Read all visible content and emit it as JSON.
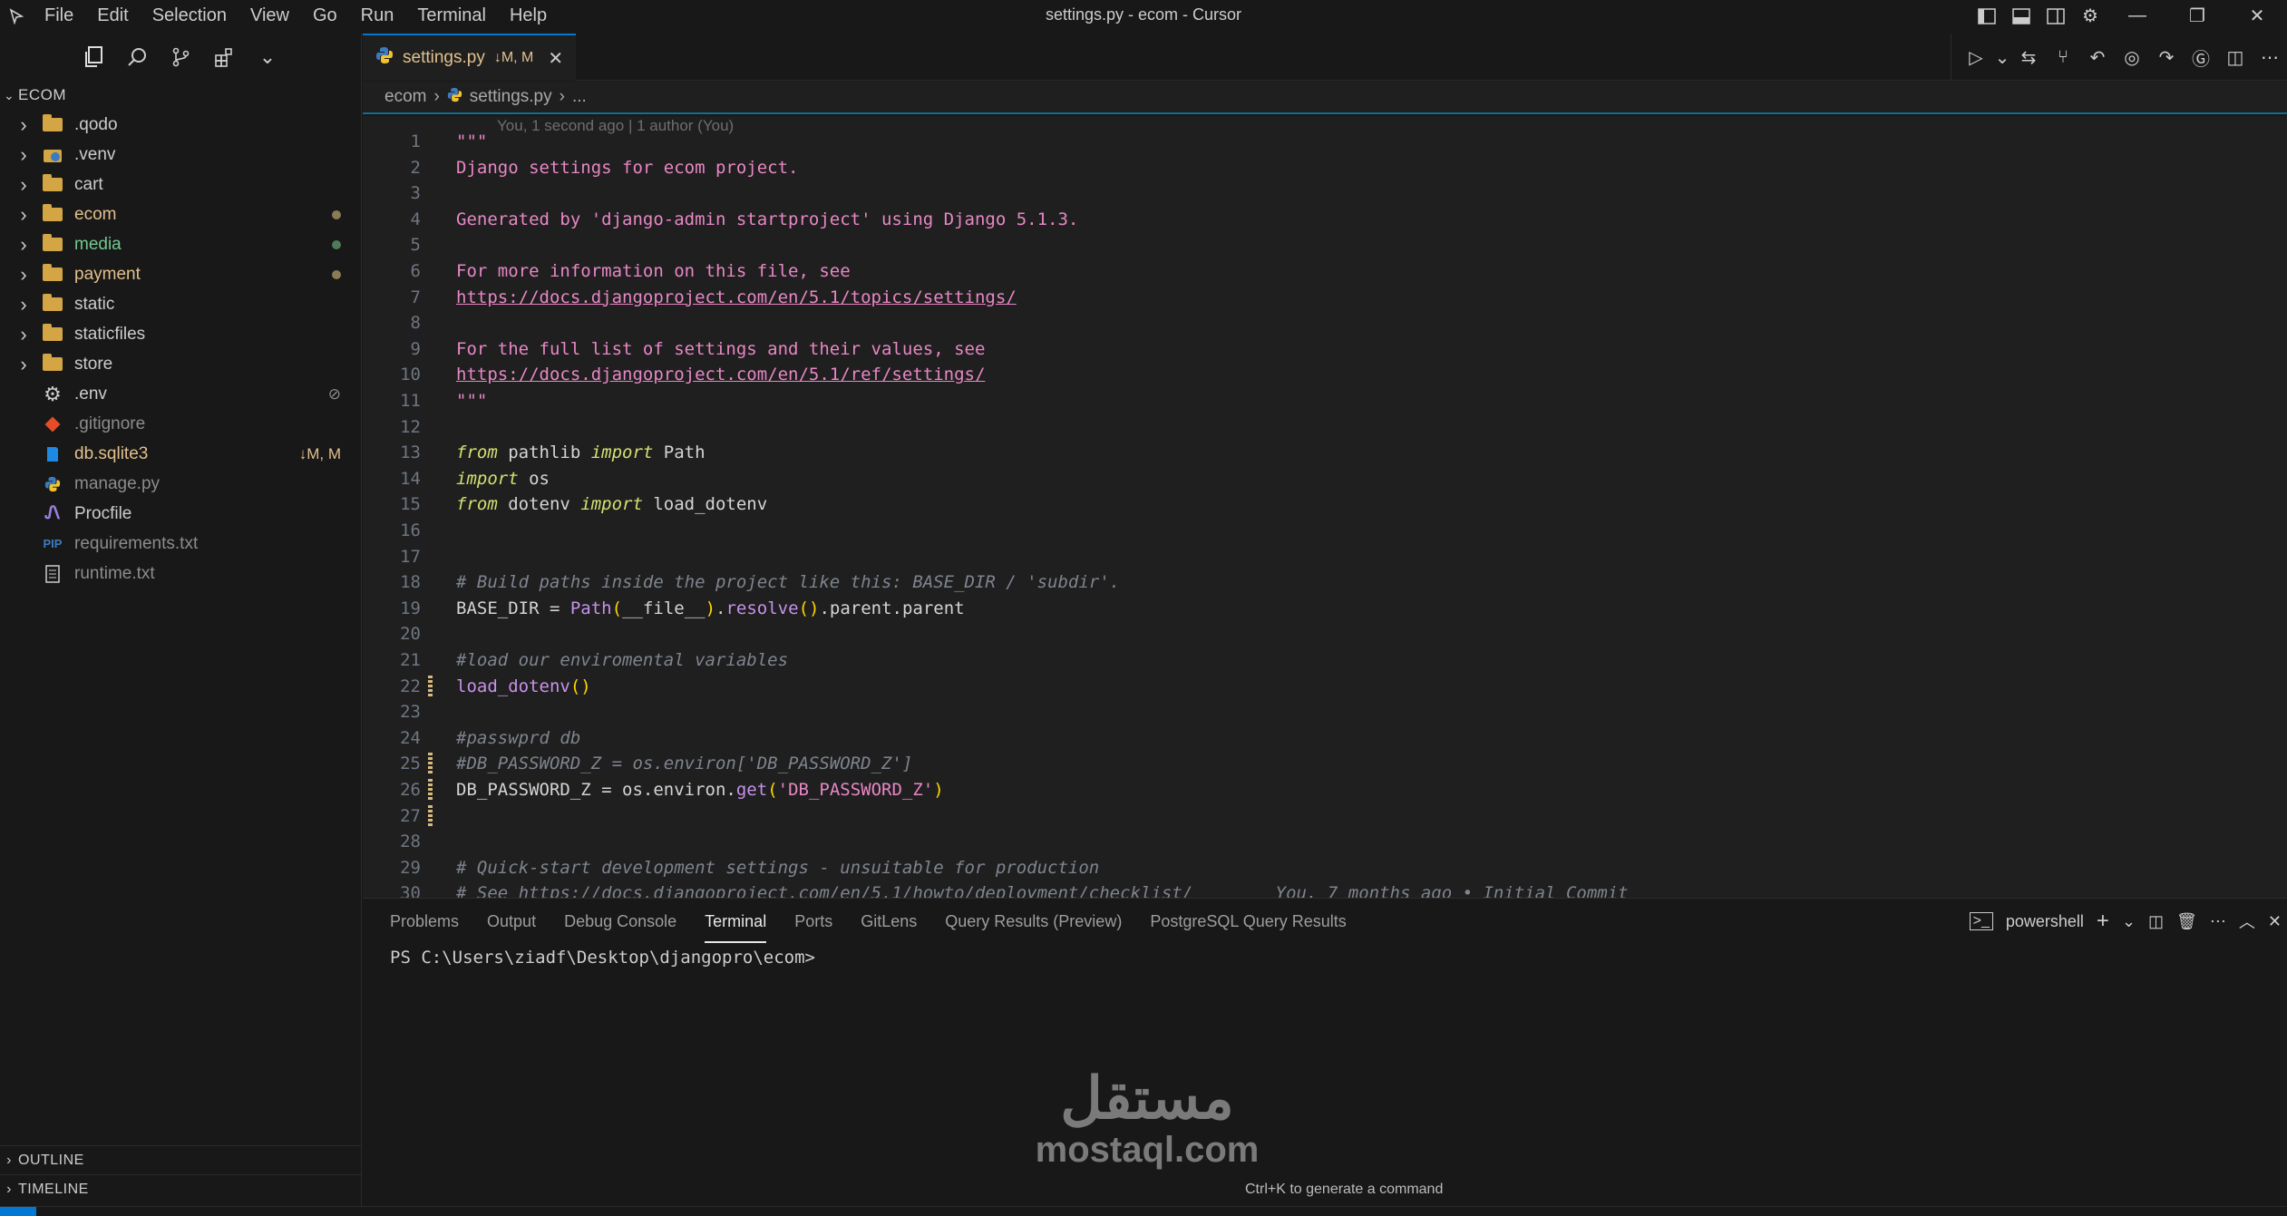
{
  "window": {
    "title": "settings.py - ecom - Cursor",
    "menu": [
      "File",
      "Edit",
      "Selection",
      "View",
      "Go",
      "Run",
      "Terminal",
      "Help"
    ]
  },
  "sidebar": {
    "root": "ECOM",
    "items": [
      {
        "name": ".qodo",
        "type": "folder",
        "color": "#cccccc",
        "decoration": ""
      },
      {
        "name": ".venv",
        "type": "venv",
        "color": "#cccccc",
        "decoration": ""
      },
      {
        "name": "cart",
        "type": "folder",
        "color": "#cccccc",
        "decoration": ""
      },
      {
        "name": "ecom",
        "type": "folder",
        "color": "#e2c08d",
        "decoration": "dot-yellow"
      },
      {
        "name": "media",
        "type": "folder",
        "color": "#73c991",
        "decoration": "dot-green"
      },
      {
        "name": "payment",
        "type": "folder",
        "color": "#e2c08d",
        "decoration": "dot-yellow"
      },
      {
        "name": "static",
        "type": "folder",
        "color": "#cccccc",
        "decoration": ""
      },
      {
        "name": "staticfiles",
        "type": "folder",
        "color": "#cccccc",
        "decoration": ""
      },
      {
        "name": "store",
        "type": "folder",
        "color": "#cccccc",
        "decoration": ""
      },
      {
        "name": ".env",
        "type": "gear",
        "color": "#cccccc",
        "decoration": "ignored"
      },
      {
        "name": ".gitignore",
        "type": "git",
        "color": "#8c8c8c",
        "decoration": ""
      },
      {
        "name": "db.sqlite3",
        "type": "db",
        "color": "#e2c08d",
        "decoration": "↓M, M"
      },
      {
        "name": "manage.py",
        "type": "python",
        "color": "#8c8c8c",
        "decoration": ""
      },
      {
        "name": "Procfile",
        "type": "procfile",
        "color": "#cccccc",
        "decoration": ""
      },
      {
        "name": "requirements.txt",
        "type": "pip",
        "color": "#8c8c8c",
        "decoration": ""
      },
      {
        "name": "runtime.txt",
        "type": "text",
        "color": "#8c8c8c",
        "decoration": ""
      }
    ],
    "outline_label": "OUTLINE",
    "timeline_label": "TIMELINE"
  },
  "tab": {
    "filename": "settings.py",
    "status": "↓M, M"
  },
  "breadcrumb": {
    "folder": "ecom",
    "file": "settings.py",
    "tail": "..."
  },
  "editor": {
    "codelens": "You, 1 second ago | 1 author (You)",
    "lines": [
      {
        "n": "1",
        "tokens": [
          [
            "c-str",
            "\"\"\""
          ]
        ]
      },
      {
        "n": "2",
        "tokens": [
          [
            "c-str",
            "Django settings for ecom project."
          ]
        ]
      },
      {
        "n": "3",
        "tokens": []
      },
      {
        "n": "4",
        "tokens": [
          [
            "c-str",
            "Generated by 'django-admin startproject' using Django 5.1.3."
          ]
        ]
      },
      {
        "n": "5",
        "tokens": []
      },
      {
        "n": "6",
        "tokens": [
          [
            "c-str",
            "For more information on this file, see"
          ]
        ]
      },
      {
        "n": "7",
        "tokens": [
          [
            "c-link",
            "https://docs.djangoproject.com/en/5.1/topics/settings/"
          ]
        ]
      },
      {
        "n": "8",
        "tokens": []
      },
      {
        "n": "9",
        "tokens": [
          [
            "c-str",
            "For the full list of settings and their values, see"
          ]
        ]
      },
      {
        "n": "10",
        "tokens": [
          [
            "c-link",
            "https://docs.djangoproject.com/en/5.1/ref/settings/"
          ]
        ]
      },
      {
        "n": "11",
        "tokens": [
          [
            "c-str",
            "\"\"\""
          ]
        ]
      },
      {
        "n": "12",
        "tokens": []
      },
      {
        "n": "13",
        "tokens": [
          [
            "c-kw",
            "from"
          ],
          [
            "c-id",
            " pathlib "
          ],
          [
            "c-kw",
            "import"
          ],
          [
            "c-id",
            " Path"
          ]
        ]
      },
      {
        "n": "14",
        "tokens": [
          [
            "c-kw",
            "import"
          ],
          [
            "c-id",
            " os"
          ]
        ]
      },
      {
        "n": "15",
        "tokens": [
          [
            "c-kw",
            "from"
          ],
          [
            "c-id",
            " dotenv "
          ],
          [
            "c-kw",
            "import"
          ],
          [
            "c-id",
            " load_dotenv"
          ]
        ]
      },
      {
        "n": "16",
        "tokens": []
      },
      {
        "n": "17",
        "tokens": []
      },
      {
        "n": "18",
        "tokens": [
          [
            "c-cm",
            "# Build paths inside the project like this: BASE_DIR / 'subdir'."
          ]
        ]
      },
      {
        "n": "19",
        "tokens": [
          [
            "c-id",
            "BASE_DIR = "
          ],
          [
            "c-fn",
            "Path"
          ],
          [
            "c-paren",
            "("
          ],
          [
            "c-id",
            "__file__"
          ],
          [
            "c-paren",
            ")"
          ],
          [
            "c-id",
            "."
          ],
          [
            "c-fn",
            "resolve"
          ],
          [
            "c-paren",
            "()"
          ],
          [
            "c-id",
            ".parent.parent"
          ]
        ]
      },
      {
        "n": "20",
        "tokens": []
      },
      {
        "n": "21",
        "tokens": [
          [
            "c-cm",
            "#load our enviromental variables"
          ]
        ]
      },
      {
        "n": "22",
        "tokens": [
          [
            "c-fn",
            "load_dotenv"
          ],
          [
            "c-paren",
            "()"
          ]
        ],
        "mark": true
      },
      {
        "n": "23",
        "tokens": []
      },
      {
        "n": "24",
        "tokens": [
          [
            "c-cm",
            "#passwprd db"
          ]
        ]
      },
      {
        "n": "25",
        "tokens": [
          [
            "c-cm",
            "#DB_PASSWORD_Z = os.environ['DB_PASSWORD_Z']"
          ]
        ],
        "mark": true
      },
      {
        "n": "26",
        "tokens": [
          [
            "c-id",
            "DB_PASSWORD_Z = os.environ."
          ],
          [
            "c-fn",
            "get"
          ],
          [
            "c-paren",
            "("
          ],
          [
            "c-str",
            "'DB_PASSWORD_Z'"
          ],
          [
            "c-paren",
            ")"
          ]
        ],
        "mark": true
      },
      {
        "n": "27",
        "tokens": [],
        "mark": true
      },
      {
        "n": "28",
        "tokens": []
      },
      {
        "n": "29",
        "tokens": [
          [
            "c-cm",
            "# Quick-start development settings - unsuitable for production"
          ]
        ]
      },
      {
        "n": "30",
        "tokens": [
          [
            "c-cm",
            "# See https://docs.djangoproject.com/en/5.1/howto/deployment/checklist/        You, 7 months ago • Initial Commit"
          ]
        ]
      }
    ]
  },
  "panel": {
    "tabs": [
      "Problems",
      "Output",
      "Debug Console",
      "Terminal",
      "Ports",
      "GitLens",
      "Query Results (Preview)",
      "PostgreSQL Query Results"
    ],
    "active_tab": "Terminal",
    "shell": "powershell",
    "prompt": "PS C:\\Users\\ziadf\\Desktop\\djangopro\\ecom>",
    "hint": "Ctrl+K to generate a command"
  },
  "watermark": {
    "arabic": "مستقل",
    "latin": "mostaql.com"
  }
}
